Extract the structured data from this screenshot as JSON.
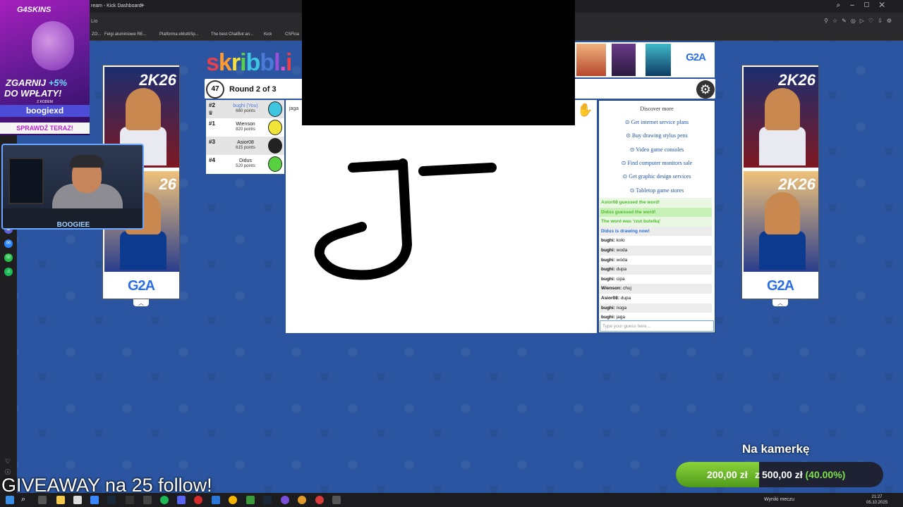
{
  "browser": {
    "tab_title": "ream - Kick Dashboard",
    "tab_plus": "+",
    "url_fragment": "Lio",
    "bookmarks": [
      "ZO...",
      "Felgi aluminiowe RE...",
      "Platforma eMultiSp...",
      "The best ChatBot an...",
      "Kick",
      "CSFloa"
    ]
  },
  "promo": {
    "brand": "G4SKINS",
    "line1_prefix": "ZGARNIJ ",
    "line1_bonus": "+5%",
    "line2": "DO WPŁATY!",
    "small": "Z KODEM",
    "code": "boogiexd",
    "cta": "SPRAWDŹ TERAZ!"
  },
  "webcam": {
    "label": "BOOGIEE"
  },
  "game": {
    "logo": "skribbl.i",
    "timer": "47",
    "round": "Round 2 of 3",
    "word_hint": "jaga",
    "players": [
      {
        "rank": "#2",
        "name": "bughi (You)",
        "points": "680 points",
        "you": true,
        "color": "#3fc5e0"
      },
      {
        "rank": "#1",
        "name": "Wienson",
        "points": "820 points",
        "you": false,
        "color": "#f2e53a"
      },
      {
        "rank": "#3",
        "name": "Asior08",
        "points": "615 points",
        "you": false,
        "color": "#222222"
      },
      {
        "rank": "#4",
        "name": "Didus",
        "points": "520 points",
        "you": false,
        "color": "#57d13f"
      }
    ]
  },
  "chat": {
    "discover_title": "Discover more",
    "links": [
      "⊙ Get internet service plans",
      "⊙ Buy drawing stylus pens",
      "⊙ Video game consoles",
      "⊙ Find computer monitors sale",
      "⊙ Get graphic design services",
      "⊙ Tabletop game stores"
    ],
    "messages": [
      {
        "text": "Asior08 guessed the word!",
        "kind": "green"
      },
      {
        "text": "Didus guessed the word!",
        "kind": "green-lg"
      },
      {
        "text": "The word was 'rzut butelką'",
        "kind": "green"
      },
      {
        "text": "Didus is drawing now!",
        "kind": "blue"
      },
      {
        "user": "bughi:",
        "text": " koło",
        "kind": "normal"
      },
      {
        "user": "bughi:",
        "text": " woda",
        "kind": "alt"
      },
      {
        "user": "bughi:",
        "text": " wóda",
        "kind": "normal"
      },
      {
        "user": "bughi:",
        "text": " dupa",
        "kind": "alt"
      },
      {
        "user": "bughi:",
        "text": " cipa",
        "kind": "normal"
      },
      {
        "user": "Wienson:",
        "text": " chuj",
        "kind": "alt"
      },
      {
        "user": "Asior08:",
        "text": " dupa",
        "kind": "normal"
      },
      {
        "user": "bughi:",
        "text": " noga",
        "kind": "alt"
      },
      {
        "user": "bughi:",
        "text": " jaga",
        "kind": "normal"
      }
    ],
    "guess_placeholder": "Type your guess here..."
  },
  "ads": {
    "g2a": "G2A",
    "num": "26",
    "num_prefix": "2K"
  },
  "overlay": {
    "giveaway": "GIVEAWAY na 25 follow!",
    "camera_title": "Na kamerkę",
    "current": "200,00 zł",
    "z": "z",
    "goal": "500,00 zł",
    "pct": "(40.00%)",
    "progress": 0.4
  },
  "taskbar": {
    "weather": "Wyniki meczu",
    "time": "21:27",
    "date": "05.10.2025"
  }
}
